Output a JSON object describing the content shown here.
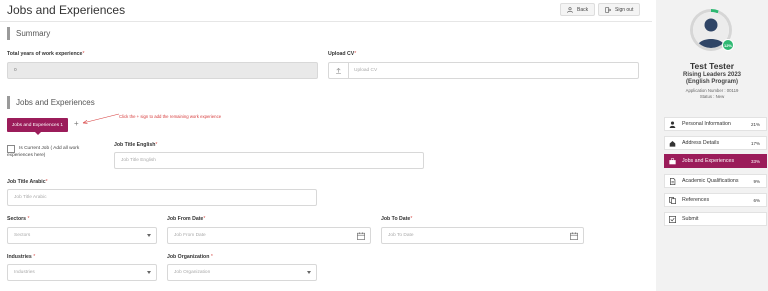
{
  "header": {
    "title": "Jobs and Experiences",
    "back_label": "Back",
    "signout_label": "Sign out"
  },
  "summary": {
    "section_title": "Summary",
    "experience_label": "Total years of work experience",
    "experience_value": "0",
    "upload_label": "Upload CV",
    "upload_placeholder": "Upload CV"
  },
  "jobs": {
    "section_title": "Jobs and Experiences",
    "tab_label": "Jobs and Experiences 1",
    "add_symbol": "+",
    "hint": "Click the + sign to add the remaining work experience",
    "current_job_label": "Is Current Job ( Add all work experiences here)",
    "title_en_label": "Job Title English",
    "title_en_placeholder": "Job Title English",
    "title_ar_label": "Job Title Arabic",
    "title_ar_placeholder": "Job Title Arabic",
    "sectors_label": "Sectors",
    "sectors_value": "Sectors",
    "from_label": "Job From Date",
    "from_placeholder": "Job From Date",
    "to_label": "Job To Date",
    "to_placeholder": "Job To Date",
    "industries_label": "Industries",
    "industries_value": "Industries",
    "org_label": "Job Organization",
    "org_value": "Job Organization"
  },
  "profile": {
    "name": "Test Tester",
    "program_line1": "Rising Leaders 2023",
    "program_line2": "(English Program)",
    "application_number": "Application Number : 00119",
    "status": "Status : New",
    "completion_pct": "12%",
    "completion_fraction": 0.06
  },
  "nav": [
    {
      "label": "Personal Information",
      "pct": "21%",
      "icon": "user-icon"
    },
    {
      "label": "Address Details",
      "pct": "17%",
      "icon": "home-icon"
    },
    {
      "label": "Jobs and Experiences",
      "pct": "33%",
      "icon": "briefcase-icon"
    },
    {
      "label": "Academic Qualifications",
      "pct": "9%",
      "icon": "document-icon"
    },
    {
      "label": "References",
      "pct": "6%",
      "icon": "references-icon"
    },
    {
      "label": "Submit",
      "pct": "",
      "icon": "submit-icon"
    }
  ],
  "colors": {
    "accent": "#9b1c5a",
    "progress": "#2eb872",
    "required": "#d9534f",
    "hint": "#d63b3b"
  }
}
